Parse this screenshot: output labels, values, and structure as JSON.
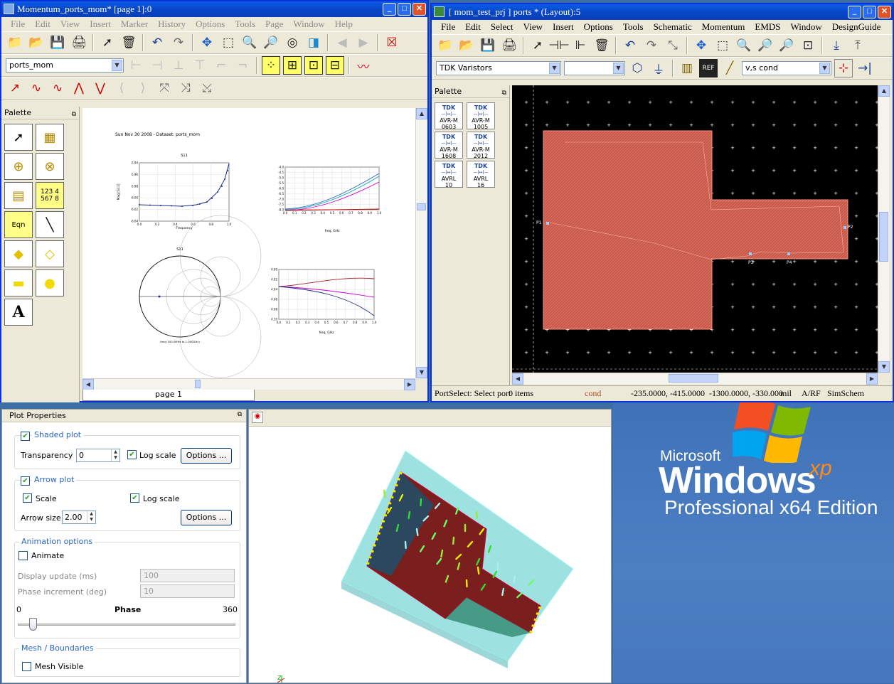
{
  "desktop": {
    "brand": "Microsoft",
    "product": "Windows",
    "superscript": "xp",
    "edition": "Professional x64 Edition"
  },
  "win1": {
    "title": "Momentum_ports_mom* [page 1]:0",
    "menu": [
      "File",
      "Edit",
      "View",
      "Insert",
      "Marker",
      "History",
      "Options",
      "Tools",
      "Page",
      "Window",
      "Help"
    ],
    "dataset_combo": "ports_mom",
    "palette_label": "Palette",
    "palette_eqn": "Eqn",
    "palette_table": "123 4\n567 8",
    "palette_text": "A",
    "page_header": "Sun Nov 30 2008 - Dataset: ports_mom",
    "plot1": {
      "title": "S11",
      "ylabel": "Mag [S11]",
      "xlabel": "Frequency",
      "yticks": [
        "-5.94",
        "-5.96",
        "-5.98",
        "-6.00",
        "-6.02",
        "-6.04"
      ],
      "xticks": [
        "0.0",
        "0.2",
        "0.4",
        "0.6",
        "0.8",
        "1.0"
      ]
    },
    "plot2": {
      "xlabel": "freq, GHz",
      "yticks": [
        "-4.0",
        "-4.5",
        "-5.0",
        "-5.5",
        "-6.0",
        "-6.5",
        "-7.0",
        "-7.5",
        "-8.0"
      ],
      "xticks": [
        "0.0",
        "0.1",
        "0.2",
        "0.3",
        "0.4",
        "0.5",
        "0.6",
        "0.7",
        "0.8",
        "0.9",
        "1.0"
      ]
    },
    "plot3": {
      "title": "S11",
      "xlabel": "freq (100.0MHz to 1.000GHz)"
    },
    "plot4": {
      "xlabel": "freq, GHz",
      "yticks": [
        "4.00",
        "4.02",
        "4.04",
        "4.06",
        "4.08",
        "4.10"
      ],
      "xticks": [
        "0.0",
        "0.1",
        "0.2",
        "0.3",
        "0.4",
        "0.5",
        "0.6",
        "0.7",
        "0.8",
        "0.9",
        "1.0"
      ]
    },
    "page_tab": "page 1"
  },
  "win2": {
    "title": "[ mom_test_prj ] ports * (Layout):5",
    "menu": [
      "File",
      "Edit",
      "Select",
      "View",
      "Insert",
      "Options",
      "Tools",
      "Schematic",
      "Momentum",
      "EMDS",
      "Window",
      "DesignGuide"
    ],
    "library_combo": "TDK Varistors",
    "layer_combo": "v,s cond",
    "palette_label": "Palette",
    "tdk_items": [
      {
        "brand": "TDK",
        "name": "AVR-M",
        "size": "0603"
      },
      {
        "brand": "TDK",
        "name": "AVR-M",
        "size": "1005"
      },
      {
        "brand": "TDK",
        "name": "AVR-M",
        "size": "1608"
      },
      {
        "brand": "TDK",
        "name": "AVR-M",
        "size": "2012"
      },
      {
        "brand": "TDK",
        "name": "AVRL",
        "size": "10"
      },
      {
        "brand": "TDK",
        "name": "AVRL",
        "size": "16"
      }
    ],
    "ports": [
      "P1",
      "P2",
      "P3",
      "P4"
    ],
    "status": {
      "prompt": "PortSelect: Select port",
      "items": "0 items",
      "layer": "cond",
      "coords": "-235.0000, -415.0000",
      "coords2": "-1300.0000, -330.000",
      "unit": "mil",
      "mode": "A/RF",
      "sim": "SimSchem"
    }
  },
  "props": {
    "title": "Plot Properties",
    "shaded": {
      "label": "Shaded plot",
      "transparency_label": "Transparency",
      "transparency": "0",
      "log_label": "Log scale",
      "options": "Options ..."
    },
    "arrow": {
      "label": "Arrow plot",
      "scale": "Scale",
      "log_label": "Log scale",
      "size_label": "Arrow size",
      "size": "2.00",
      "options": "Options ..."
    },
    "anim": {
      "label": "Animation options",
      "animate": "Animate",
      "update_label": "Display update (ms)",
      "update": "100",
      "phase_inc_label": "Phase increment (deg)",
      "phase_inc": "10",
      "phase_min": "0",
      "phase_label": "Phase",
      "phase_max": "360",
      "phase_value": 25
    },
    "mesh": {
      "label": "Mesh / Boundaries",
      "visible": "Mesh Visible"
    }
  }
}
